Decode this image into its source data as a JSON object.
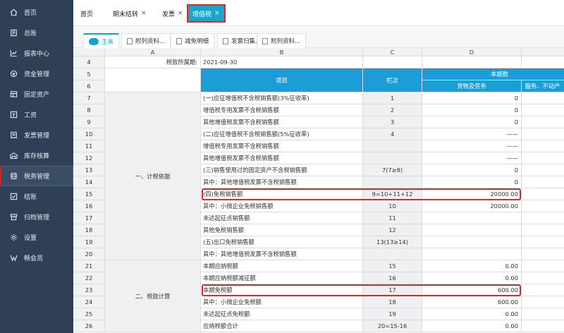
{
  "sidebar": {
    "items": [
      {
        "label": "首页",
        "icon": "home-icon",
        "active": false
      },
      {
        "label": "总账",
        "icon": "ledger-icon",
        "active": false
      },
      {
        "label": "报表中心",
        "icon": "chart-icon",
        "active": false
      },
      {
        "label": "资金管理",
        "icon": "money-icon",
        "active": false
      },
      {
        "label": "固定资产",
        "icon": "asset-icon",
        "active": false
      },
      {
        "label": "工资",
        "icon": "salary-icon",
        "active": false
      },
      {
        "label": "发票管理",
        "icon": "invoice-icon",
        "active": false
      },
      {
        "label": "库存核算",
        "icon": "warehouse-icon",
        "active": false
      },
      {
        "label": "税务管理",
        "icon": "tax-icon",
        "active": true
      },
      {
        "label": "结账",
        "icon": "checkout-icon",
        "active": false
      },
      {
        "label": "归档管理",
        "icon": "archive-icon",
        "active": false
      },
      {
        "label": "设置",
        "icon": "gear-icon",
        "active": false
      },
      {
        "label": "畅会员",
        "icon": "vip-icon",
        "active": false
      }
    ]
  },
  "tabs": [
    {
      "label": "首页",
      "closable": false
    },
    {
      "label": "期末结转",
      "closable": true
    },
    {
      "label": "发票",
      "closable": true
    },
    {
      "label": "增值税",
      "closable": true,
      "active": true
    }
  ],
  "close_symbol": "×",
  "subtabs": [
    "主表",
    "附列资料...",
    "减免明细",
    "发票归集...",
    "附列资料..."
  ],
  "sheet": {
    "col_headers": [
      "A",
      "B",
      "C",
      "D"
    ],
    "period_label": "税款所属期:",
    "period_value": "2021-09-30",
    "hdr_item": "项目",
    "hdr_col": "栏次",
    "hdr_current": "本期数",
    "hdr_goods": "货物及劳务",
    "hdr_services": "服务、不动产",
    "section1": "一、计税依据",
    "section2": "二、税款计算",
    "rows": [
      {
        "n": "7",
        "item": "(一)应征增值税不含税销售额(3%征收率)",
        "col": "1",
        "val": "0"
      },
      {
        "n": "8",
        "item": "增值税专用发票不含税销售额",
        "col": "2",
        "val": "0"
      },
      {
        "n": "9",
        "item": "其他增值税发票不含税销售额",
        "col": "3",
        "val": "0"
      },
      {
        "n": "10",
        "item": "(二)应征增值税不含税销售额(5%征收率)",
        "col": "4",
        "val": "——"
      },
      {
        "n": "11",
        "item": "增值税专用发票不含税销售额",
        "col": "",
        "val": "——"
      },
      {
        "n": "12",
        "item": "其他增值税发票不含税销售额",
        "col": "",
        "val": "——"
      },
      {
        "n": "13",
        "item": "(三)销售使用过的固定资产不含税销售额",
        "col": "7(7≥8)",
        "val": "0"
      },
      {
        "n": "14",
        "item": "其中：其他增值税发票不含税销售额",
        "col": "",
        "val": "0"
      },
      {
        "n": "15",
        "item": "(四)免税销售额",
        "col": "9=10+11+12",
        "val": "20000.00"
      },
      {
        "n": "16",
        "item": "其中：小微企业免税销售额",
        "col": "10",
        "val": "20000.00"
      },
      {
        "n": "17",
        "item": "未达起征点销售额",
        "col": "11",
        "val": ""
      },
      {
        "n": "18",
        "item": "其他免税销售额",
        "col": "12",
        "val": ""
      },
      {
        "n": "19",
        "item": "(五)出口免税销售额",
        "col": "13(13≥14)",
        "val": ""
      },
      {
        "n": "20",
        "item": "其中：其他增值税发票不含税销售额",
        "col": "",
        "val": ""
      },
      {
        "n": "21",
        "item": "本期应纳税额",
        "col": "15",
        "val": "0.00"
      },
      {
        "n": "22",
        "item": "本期应纳税额减征额",
        "col": "16",
        "val": "0.00"
      },
      {
        "n": "23",
        "item": "本期免税额",
        "col": "17",
        "val": "600.00"
      },
      {
        "n": "24",
        "item": "其中：小微企业免税额",
        "col": "18",
        "val": "600.00"
      },
      {
        "n": "25",
        "item": "未达起征点免税额",
        "col": "19",
        "val": "0.00"
      },
      {
        "n": "26",
        "item": "应纳税额合计",
        "col": "20=15-16",
        "val": "0.00"
      }
    ]
  },
  "colors": {
    "sidebar": "#2f3f55",
    "accent": "#1b9ed8",
    "highlight": "#d42b2b"
  }
}
